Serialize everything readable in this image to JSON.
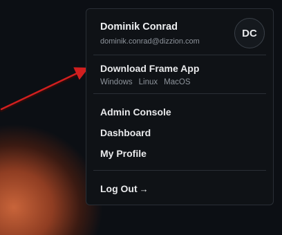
{
  "user": {
    "name": "Dominik Conrad",
    "email": "dominik.conrad@dizzion.com",
    "initials": "DC"
  },
  "download": {
    "title": "Download Frame App",
    "platforms": [
      "Windows",
      "Linux",
      "MacOS"
    ]
  },
  "nav": {
    "admin_console": "Admin Console",
    "dashboard": "Dashboard",
    "my_profile": "My Profile"
  },
  "logout": {
    "label": "Log Out",
    "icon": "→"
  },
  "colors": {
    "menu_bg": "#0f1216",
    "menu_border": "#2a2f36",
    "text_primary": "#e9eaec",
    "text_secondary": "#8d939b",
    "annotation_arrow": "#d11f1f"
  }
}
